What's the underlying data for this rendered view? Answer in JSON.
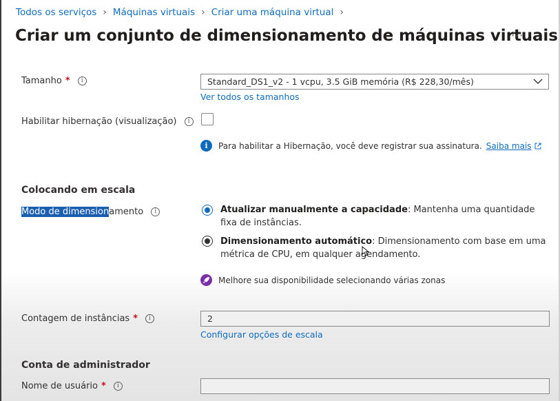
{
  "breadcrumb": [
    "Todos os serviços",
    "Máquinas virtuais",
    "Criar uma máquina virtual"
  ],
  "title": "Criar um conjunto de dimensionamento de máquinas virtuais",
  "more_label": "···",
  "size": {
    "label": "Tamanho",
    "required": "*",
    "value": "Standard_DS1_v2 - 1 vcpu, 3.5 GiB memória (R$ 228,30/mês)",
    "see_all_link": "Ver todos os tamanhos"
  },
  "hibernation": {
    "label": "Habilitar hibernação (visualização)",
    "checked": false,
    "info_text": "Para habilitar a Hibernação, você deve registrar sua assinatura.",
    "learn_more": "Saiba mais"
  },
  "scale": {
    "section_title": "Colocando em escala",
    "mode_label_selected": "Modo de dimension",
    "mode_label_rest": "amento",
    "options": [
      {
        "title": "Atualizar manualmente a capacidade",
        "desc": ": Mantenha uma quantidade fixa de instâncias.",
        "selected": true
      },
      {
        "title": "Dimensionamento automático",
        "desc": ": Dimensionamento com base em uma métrica de CPU, em qualquer agendamento.",
        "selected": false
      }
    ],
    "zones_tip": "Melhore sua disponibilidade selecionando várias zonas"
  },
  "instances": {
    "label": "Contagem de instâncias",
    "required": "*",
    "value": "2",
    "config_link": "Configurar opções de escala"
  },
  "admin": {
    "section_title": "Conta de administrador",
    "username_label": "Nome de usuário",
    "required": "*",
    "username_value": ""
  },
  "colors": {
    "link": "#0f6cbd",
    "required": "#c50f1f",
    "selection": "#1a5eb0",
    "rocket": "#7b2fa6"
  },
  "icons": [
    "chevron-right-icon",
    "more-icon",
    "info-icon",
    "chevron-down-icon",
    "info-filled-icon",
    "external-link-icon",
    "rocket-icon",
    "mouse-cursor-icon"
  ]
}
